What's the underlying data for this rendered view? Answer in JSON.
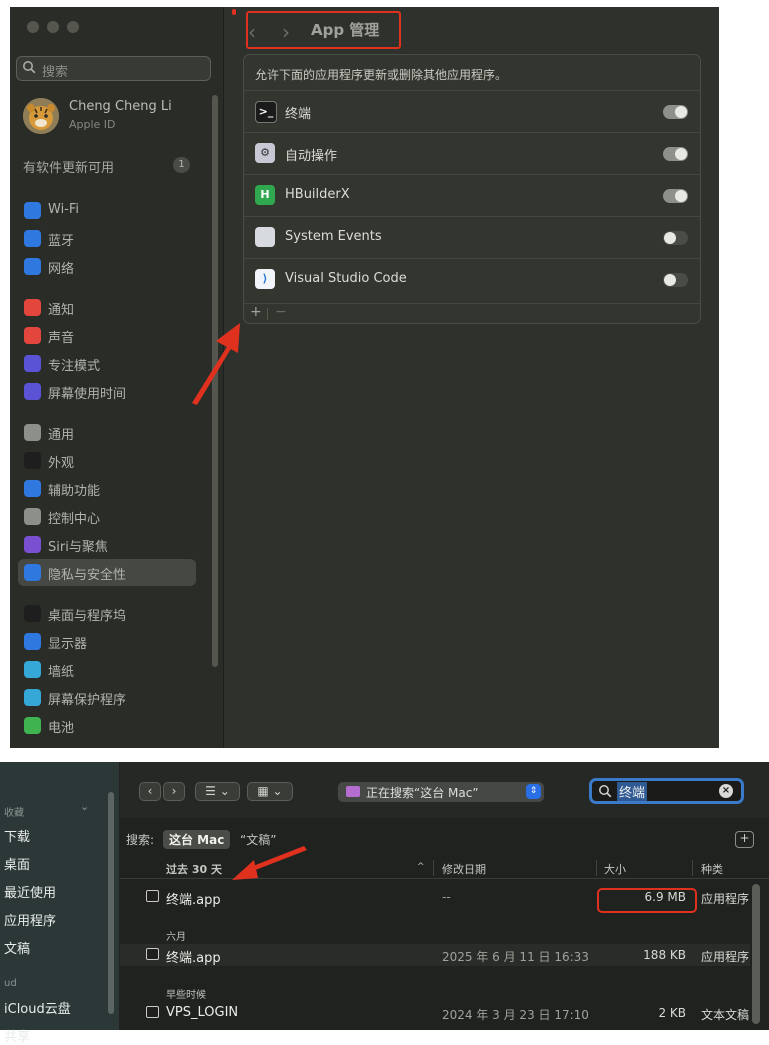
{
  "settings": {
    "search_placeholder": "搜索",
    "user": {
      "name": "Cheng Cheng Li",
      "sub": "Apple ID"
    },
    "update": {
      "label": "有软件更新可用",
      "count": "1"
    },
    "groups": [
      [
        {
          "label": "Wi-Fi",
          "icon": "wifi-icon",
          "color": "#2f78e0"
        },
        {
          "label": "蓝牙",
          "icon": "bluetooth-icon",
          "color": "#2f78e0"
        },
        {
          "label": "网络",
          "icon": "globe-icon",
          "color": "#2f78e0"
        }
      ],
      [
        {
          "label": "通知",
          "icon": "bell-icon",
          "color": "#e2463c"
        },
        {
          "label": "声音",
          "icon": "speaker-icon",
          "color": "#e2463c"
        },
        {
          "label": "专注模式",
          "icon": "moon-icon",
          "color": "#5b53d6"
        },
        {
          "label": "屏幕使用时间",
          "icon": "hourglass-icon",
          "color": "#5b53d6"
        }
      ],
      [
        {
          "label": "通用",
          "icon": "gear-icon",
          "color": "#8d8f8a"
        },
        {
          "label": "外观",
          "icon": "appearance-icon",
          "color": "#1e1e1e"
        },
        {
          "label": "辅助功能",
          "icon": "accessibility-icon",
          "color": "#2f78e0"
        },
        {
          "label": "控制中心",
          "icon": "control-center-icon",
          "color": "#8d8f8a"
        },
        {
          "label": "Siri与聚焦",
          "icon": "siri-icon",
          "color": "#7a4fd0"
        },
        {
          "label": "隐私与安全性",
          "icon": "hand-icon",
          "color": "#2f78e0",
          "selected": true
        }
      ],
      [
        {
          "label": "桌面与程序坞",
          "icon": "dock-icon",
          "color": "#1e1e1e"
        },
        {
          "label": "显示器",
          "icon": "sun-icon",
          "color": "#2f78e0"
        },
        {
          "label": "墙纸",
          "icon": "flower-icon",
          "color": "#35a8d8"
        },
        {
          "label": "屏幕保护程序",
          "icon": "screensaver-icon",
          "color": "#35a8d8"
        },
        {
          "label": "电池",
          "icon": "battery-icon",
          "color": "#3fb34f"
        }
      ]
    ],
    "header": {
      "back": "‹",
      "forward": "›",
      "title": "App 管理"
    },
    "panel_desc": "允许下面的应用程序更新或删除其他应用程序。",
    "apps": [
      {
        "name": "终端",
        "icon": "terminal-icon",
        "on": true
      },
      {
        "name": "自动操作",
        "icon": "automator-icon",
        "on": true
      },
      {
        "name": "HBuilderX",
        "icon": "hbuilderx-icon",
        "on": true
      },
      {
        "name": "System Events",
        "icon": "system-events-icon",
        "on": false
      },
      {
        "name": "Visual Studio Code",
        "icon": "vscode-icon",
        "on": false
      }
    ],
    "footer": {
      "plus": "+",
      "minus": "−"
    }
  },
  "finder": {
    "sidebar": {
      "favorites_header": "收藏",
      "items": [
        "下载",
        "桌面",
        "最近使用",
        "应用程序",
        "文稿"
      ],
      "cloud_header": "ud",
      "cloud_items": [
        "iCloud云盘",
        "共享"
      ]
    },
    "toolbar": {
      "back": "‹",
      "forward": "›",
      "list_view": "☰ ⌄",
      "grid_view": "▦ ⌄"
    },
    "scope_title": "正在搜索“这台 Mac”",
    "search_value": "终端",
    "scope_label": "搜索:",
    "scope_selected": "这台 Mac",
    "scope_other": "“文稿”",
    "add": "+",
    "columns": {
      "name": "过去 30 天",
      "date": "修改日期",
      "size": "大小",
      "kind": "种类"
    },
    "groups": [
      {
        "header": "过去 30 天",
        "rows": [
          {
            "name": "终端.app",
            "date": "--",
            "size": "6.9 MB",
            "kind": "应用程序"
          }
        ]
      },
      {
        "header": "六月",
        "rows": [
          {
            "name": "终端.app",
            "date": "2025 年 6 月 11 日 16:33",
            "size": "188 KB",
            "kind": "应用程序"
          }
        ]
      },
      {
        "header": "早些时候",
        "rows": [
          {
            "name": "VPS_LOGIN",
            "date": "2024 年 3 月 23 日 17:10",
            "size": "2 KB",
            "kind": "文本文稿"
          }
        ]
      }
    ]
  },
  "colors": {
    "annotation_red": "#e0311f",
    "toggle_on": "#8e908a",
    "toggle_off": "#4a4c46",
    "accent_blue": "#3a7ac8"
  }
}
